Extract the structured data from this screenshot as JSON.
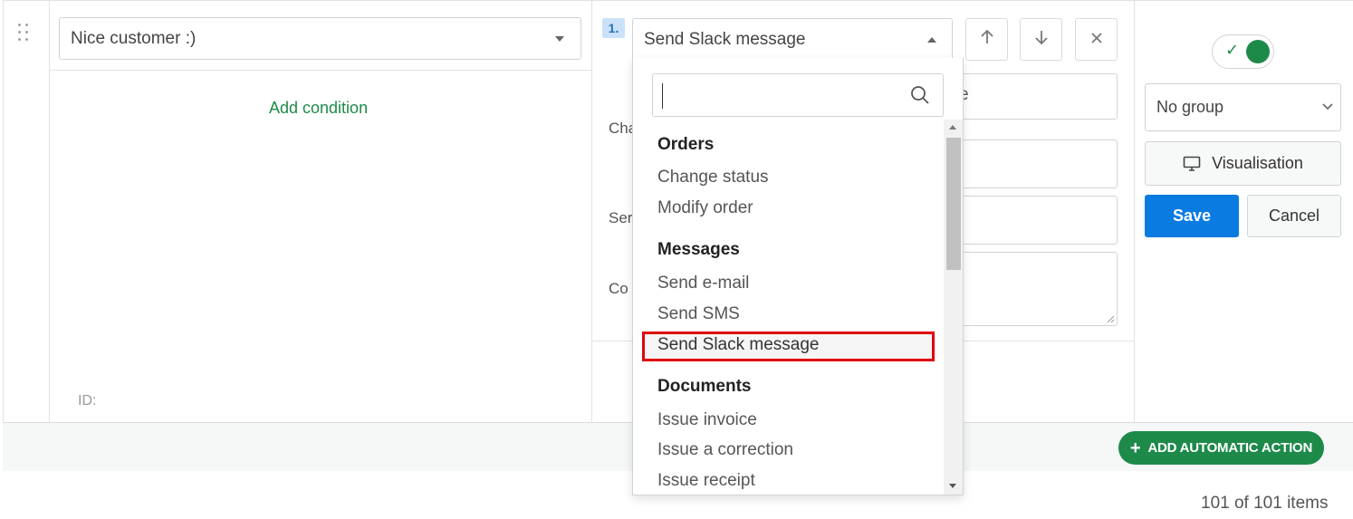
{
  "condition_panel": {
    "select_value": "Nice customer :)",
    "add_condition_label": "Add condition",
    "id_label": "ID:"
  },
  "action_panel": {
    "step_number": "1.",
    "action_select_value": "Send Slack message",
    "field_labels": [
      "Cha",
      "Ser",
      "Co"
    ],
    "field_behind_text": "e"
  },
  "dropdown": {
    "search_value": "",
    "groups": [
      {
        "label": "Orders",
        "items": [
          "Change status",
          "Modify order"
        ]
      },
      {
        "label": "Messages",
        "items": [
          "Send e-mail",
          "Send SMS",
          "Send Slack message"
        ]
      },
      {
        "label": "Documents",
        "items": [
          "Issue invoice",
          "Issue a correction",
          "Issue receipt"
        ]
      }
    ],
    "highlighted_item": "Send Slack message"
  },
  "right_panel": {
    "toggle_state": "on",
    "group_select_value": "No group",
    "visualisation_label": "Visualisation",
    "save_label": "Save",
    "cancel_label": "Cancel"
  },
  "footer": {
    "add_action_label": "ADD AUTOMATIC ACTION",
    "pager_text": "101 of 101 items"
  },
  "colors": {
    "accent_green": "#1e8a4a",
    "primary_blue": "#0a7be0",
    "highlight_red": "#e0000f"
  }
}
